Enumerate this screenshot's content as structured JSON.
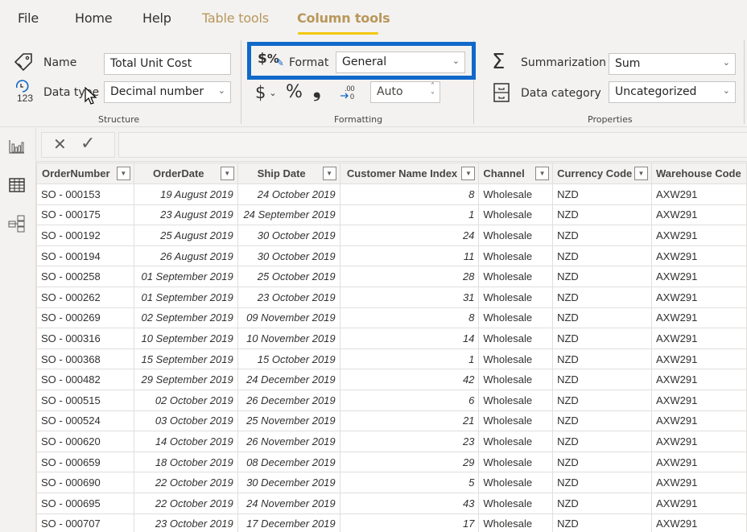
{
  "tabs": [
    {
      "label": "File",
      "state": "normal"
    },
    {
      "label": "Home",
      "state": "normal"
    },
    {
      "label": "Help",
      "state": "normal"
    },
    {
      "label": "Table tools",
      "state": "contextual"
    },
    {
      "label": "Column tools",
      "state": "active"
    }
  ],
  "ribbon": {
    "structure": {
      "group_label": "Structure",
      "name_label": "Name",
      "name_value": "Total Unit Cost",
      "datatype_label": "Data type",
      "datatype_value": "Decimal number"
    },
    "formatting": {
      "group_label": "Formatting",
      "format_label": "Format",
      "format_value": "General",
      "currency_symbol": "$",
      "percent_symbol": "%",
      "comma_symbol": "❟",
      "decimal_symbol": ".00",
      "decimals_value": "Auto"
    },
    "properties": {
      "group_label": "Properties",
      "summarization_label": "Summarization",
      "summarization_value": "Sum",
      "datacategory_label": "Data category",
      "datacategory_value": "Uncategorized"
    }
  },
  "highlight_color": "#1069c9",
  "accent_color": "#f2c811",
  "formula_bar": {
    "cancel": "✕",
    "commit": "✓",
    "value": ""
  },
  "table": {
    "columns": [
      "OrderNumber",
      "OrderDate",
      "Ship Date",
      "Customer Name Index",
      "Channel",
      "Currency Code",
      "Warehouse Code"
    ],
    "rows": [
      [
        "SO - 000153",
        "19 August 2019",
        "24 October 2019",
        "8",
        "Wholesale",
        "NZD",
        "AXW291"
      ],
      [
        "SO - 000175",
        "23 August 2019",
        "24 September 2019",
        "1",
        "Wholesale",
        "NZD",
        "AXW291"
      ],
      [
        "SO - 000192",
        "25 August 2019",
        "30 October 2019",
        "24",
        "Wholesale",
        "NZD",
        "AXW291"
      ],
      [
        "SO - 000194",
        "26 August 2019",
        "30 October 2019",
        "11",
        "Wholesale",
        "NZD",
        "AXW291"
      ],
      [
        "SO - 000258",
        "01 September 2019",
        "25 October 2019",
        "28",
        "Wholesale",
        "NZD",
        "AXW291"
      ],
      [
        "SO - 000262",
        "01 September 2019",
        "23 October 2019",
        "31",
        "Wholesale",
        "NZD",
        "AXW291"
      ],
      [
        "SO - 000269",
        "02 September 2019",
        "09 November 2019",
        "8",
        "Wholesale",
        "NZD",
        "AXW291"
      ],
      [
        "SO - 000316",
        "10 September 2019",
        "10 November 2019",
        "14",
        "Wholesale",
        "NZD",
        "AXW291"
      ],
      [
        "SO - 000368",
        "15 September 2019",
        "15 October 2019",
        "1",
        "Wholesale",
        "NZD",
        "AXW291"
      ],
      [
        "SO - 000482",
        "29 September 2019",
        "24 December 2019",
        "42",
        "Wholesale",
        "NZD",
        "AXW291"
      ],
      [
        "SO - 000515",
        "02 October 2019",
        "26 December 2019",
        "6",
        "Wholesale",
        "NZD",
        "AXW291"
      ],
      [
        "SO - 000524",
        "03 October 2019",
        "25 November 2019",
        "21",
        "Wholesale",
        "NZD",
        "AXW291"
      ],
      [
        "SO - 000620",
        "14 October 2019",
        "26 November 2019",
        "23",
        "Wholesale",
        "NZD",
        "AXW291"
      ],
      [
        "SO - 000659",
        "18 October 2019",
        "08 December 2019",
        "29",
        "Wholesale",
        "NZD",
        "AXW291"
      ],
      [
        "SO - 000690",
        "22 October 2019",
        "30 December 2019",
        "5",
        "Wholesale",
        "NZD",
        "AXW291"
      ],
      [
        "SO - 000695",
        "22 October 2019",
        "24 November 2019",
        "43",
        "Wholesale",
        "NZD",
        "AXW291"
      ],
      [
        "SO - 000707",
        "23 October 2019",
        "17 December 2019",
        "17",
        "Wholesale",
        "NZD",
        "AXW291"
      ]
    ]
  },
  "leftnav": [
    {
      "name": "report-view",
      "icon": "bar-chart-icon"
    },
    {
      "name": "data-view",
      "icon": "table-icon",
      "active": true
    },
    {
      "name": "model-view",
      "icon": "model-icon"
    }
  ]
}
